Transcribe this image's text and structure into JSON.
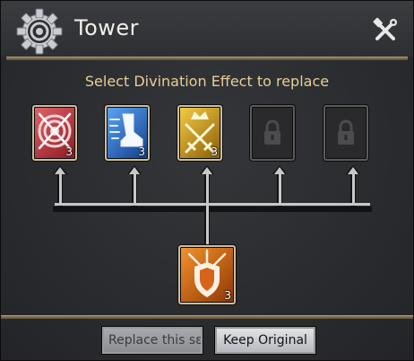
{
  "window": {
    "title": "Tower",
    "icon": "gear-icon",
    "close_icon": "crossed-tools-icon"
  },
  "prompt": "Select Divination Effect to replace",
  "effects": [
    {
      "icon": "target-crossed-swords-icon",
      "count": "3",
      "color": "#c2303a",
      "locked": false
    },
    {
      "icon": "winged-boot-icon",
      "count": "3",
      "color": "#2f6fcf",
      "locked": false
    },
    {
      "icon": "crossed-swords-crown-icon",
      "count": "3",
      "color": "#d8a21e",
      "locked": false
    },
    {
      "icon": "lock-icon",
      "count": "",
      "color": "#5b5b5b",
      "locked": true
    },
    {
      "icon": "lock-icon",
      "count": "",
      "color": "#5b5b5b",
      "locked": true
    }
  ],
  "new_effect": {
    "icon": "shield-swords-icon",
    "count": "3",
    "color": "#e06a14"
  },
  "buttons": {
    "replace": "Replace this sε",
    "keep": "Keep Original"
  },
  "colors": {
    "accent_gold": "#e5cf94",
    "panel_bg": "#2a2c30",
    "rule": "#8c7a58"
  }
}
